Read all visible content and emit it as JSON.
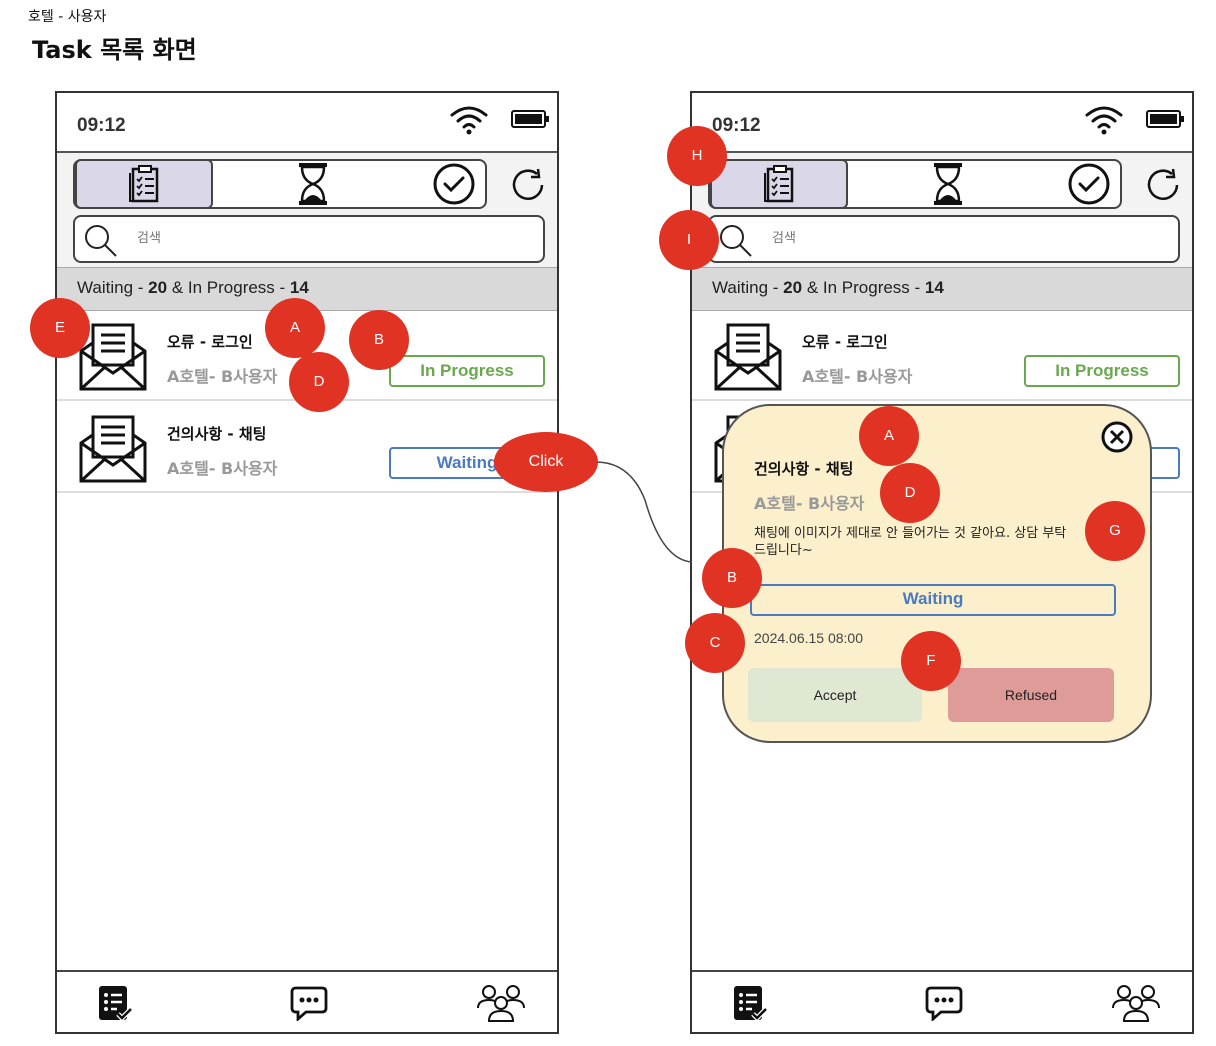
{
  "page": {
    "subtitle": "호텔 - 사용자",
    "title": "Task 목록 화면"
  },
  "status": {
    "time": "09:12"
  },
  "search": {
    "placeholder": "검색"
  },
  "counts": {
    "waiting_label": "Waiting - ",
    "waiting_count": "20",
    "connector": " & In Progress - ",
    "in_progress_count": "14"
  },
  "tasks": [
    {
      "title": "오류 - 로그인",
      "subtitle": "A호텔- B사용자",
      "status": "In Progress"
    },
    {
      "title": "건의사항 - 채팅",
      "subtitle": "A호텔- B사용자",
      "status": "Waiting"
    }
  ],
  "popup": {
    "title": "건의사항 - 채팅",
    "subtitle": "A호텔- B사용자",
    "message": "채팅에 이미지가 제대로 안 들어가는 것 같아요. 상담 부탁드립니다~",
    "status": "Waiting",
    "date": "2024.06.15 08:00",
    "accept_label": "Accept",
    "refuse_label": "Refused"
  },
  "annotations": {
    "click": "Click",
    "a": "A",
    "b": "B",
    "c": "C",
    "d": "D",
    "e": "E",
    "f": "F",
    "g": "G",
    "h": "H",
    "i": "I"
  },
  "colors": {
    "marker": "#e03324",
    "in_progress": "#6aa84f",
    "waiting": "#4a7bc0",
    "popup_bg": "#fcefcb",
    "accept_bg": "#dfe8d3",
    "refuse_bg": "#de9b98",
    "active_tab": "#d9d7e8"
  },
  "icons": [
    "wifi-icon",
    "battery-icon",
    "clipboard-list-icon",
    "hourglass-icon",
    "check-circle-icon",
    "refresh-icon",
    "search-icon",
    "envelope-letter-icon",
    "task-list-icon",
    "chat-bubble-icon",
    "users-group-icon",
    "close-icon"
  ]
}
